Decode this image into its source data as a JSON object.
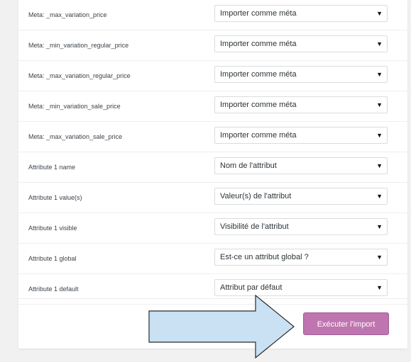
{
  "mapping_rows": [
    {
      "label": "Meta: _max_variation_price",
      "value": "Importer comme méta"
    },
    {
      "label": "Meta: _min_variation_regular_price",
      "value": "Importer comme méta"
    },
    {
      "label": "Meta: _max_variation_regular_price",
      "value": "Importer comme méta"
    },
    {
      "label": "Meta: _min_variation_sale_price",
      "value": "Importer comme méta"
    },
    {
      "label": "Meta: _max_variation_sale_price",
      "value": "Importer comme méta"
    },
    {
      "label": "Attribute 1 name",
      "value": "Nom de l'attribut"
    },
    {
      "label": "Attribute 1 value(s)",
      "value": "Valeur(s) de l'attribut"
    },
    {
      "label": "Attribute 1 visible",
      "value": "Visibilité de l'attribut"
    },
    {
      "label": "Attribute 1 global",
      "value": "Est-ce un attribut global ?"
    },
    {
      "label": "Attribute 1 default",
      "value": "Attribut par défaut"
    }
  ],
  "actions": {
    "run_import_label": "Exécuter l'import"
  },
  "icons": {
    "select_caret": "caret-down-icon",
    "annotation": "arrow-annotation-icon"
  },
  "colors": {
    "button_bg": "#bf75b0",
    "arrow_fill": "#c9e1f3",
    "arrow_stroke": "#2b2b2b"
  }
}
